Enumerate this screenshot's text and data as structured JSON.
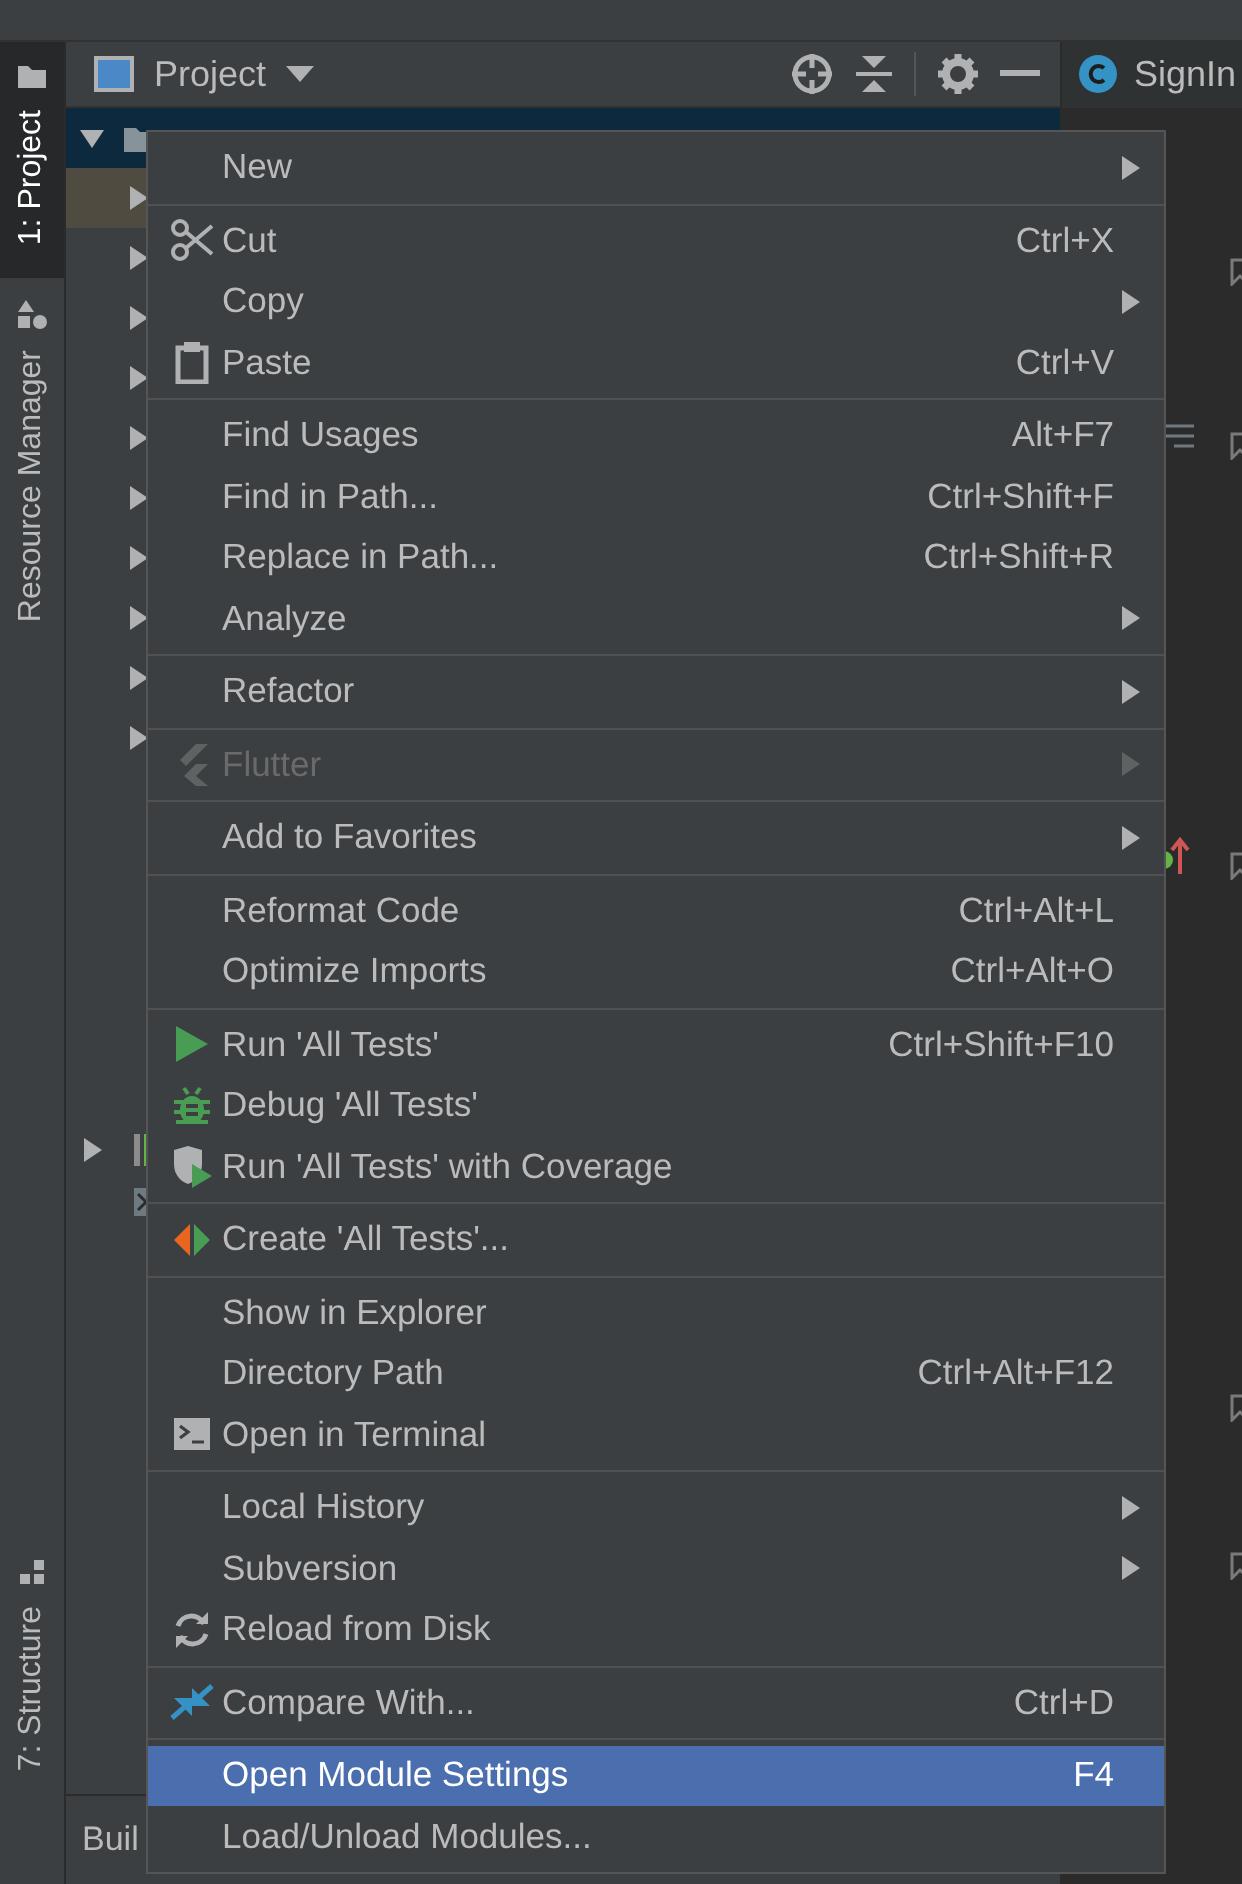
{
  "tool_strip": {
    "tabs": [
      {
        "label": "1: Project",
        "selected": true,
        "kind": "project"
      },
      {
        "label": "Resource Manager",
        "selected": false,
        "kind": "resources"
      }
    ],
    "bottom_tabs": [
      {
        "label": "7: Structure",
        "selected": false,
        "kind": "structure"
      }
    ]
  },
  "project_panel": {
    "title": "Project",
    "tree": {
      "root": {
        "expanded": true,
        "selected": true
      },
      "rows": [
        {
          "expanded": false,
          "selected": true
        },
        {
          "expanded": false,
          "selected": false
        },
        {
          "expanded": false,
          "selected": false
        },
        {
          "expanded": false,
          "selected": false
        },
        {
          "expanded": false,
          "selected": false
        },
        {
          "expanded": false,
          "selected": false
        },
        {
          "expanded": false,
          "selected": false
        },
        {
          "expanded": false,
          "selected": false
        },
        {
          "expanded": false,
          "selected": false
        },
        {
          "expanded": false,
          "selected": false
        }
      ],
      "lower_rows": [
        {
          "expanded": false,
          "kind": "library"
        },
        {
          "kind": "console"
        }
      ]
    },
    "bottom_tab": "Buil"
  },
  "editor": {
    "tab": "SignIn"
  },
  "context_menu": {
    "groups": [
      {
        "items": [
          {
            "label": "New",
            "submenu": true,
            "disabled": false,
            "selected": false,
            "kind": "plain"
          }
        ]
      },
      {
        "items": [
          {
            "label": "Cut",
            "shortcut": "Ctrl+X",
            "submenu": false,
            "disabled": false,
            "selected": false,
            "kind": "cut"
          },
          {
            "label": "Copy",
            "submenu": true,
            "disabled": false,
            "selected": false,
            "kind": "plain"
          },
          {
            "label": "Paste",
            "shortcut": "Ctrl+V",
            "submenu": false,
            "disabled": false,
            "selected": false,
            "kind": "paste"
          }
        ]
      },
      {
        "items": [
          {
            "label": "Find Usages",
            "shortcut": "Alt+F7",
            "submenu": false,
            "disabled": false,
            "selected": false,
            "kind": "plain"
          },
          {
            "label": "Find in Path...",
            "shortcut": "Ctrl+Shift+F",
            "submenu": false,
            "disabled": false,
            "selected": false,
            "kind": "plain"
          },
          {
            "label": "Replace in Path...",
            "shortcut": "Ctrl+Shift+R",
            "submenu": false,
            "disabled": false,
            "selected": false,
            "kind": "plain"
          },
          {
            "label": "Analyze",
            "submenu": true,
            "disabled": false,
            "selected": false,
            "kind": "plain"
          }
        ]
      },
      {
        "items": [
          {
            "label": "Refactor",
            "submenu": true,
            "disabled": false,
            "selected": false,
            "kind": "plain"
          }
        ]
      },
      {
        "items": [
          {
            "label": "Flutter",
            "submenu": true,
            "disabled": true,
            "selected": false,
            "kind": "flutter"
          }
        ]
      },
      {
        "items": [
          {
            "label": "Add to Favorites",
            "submenu": true,
            "disabled": false,
            "selected": false,
            "kind": "plain"
          }
        ]
      },
      {
        "items": [
          {
            "label": "Reformat Code",
            "shortcut": "Ctrl+Alt+L",
            "submenu": false,
            "disabled": false,
            "selected": false,
            "kind": "plain"
          },
          {
            "label": "Optimize Imports",
            "shortcut": "Ctrl+Alt+O",
            "submenu": false,
            "disabled": false,
            "selected": false,
            "kind": "plain"
          }
        ]
      },
      {
        "items": [
          {
            "label": "Run 'All Tests'",
            "shortcut": "Ctrl+Shift+F10",
            "submenu": false,
            "disabled": false,
            "selected": false,
            "kind": "run"
          },
          {
            "label": "Debug 'All Tests'",
            "submenu": false,
            "disabled": false,
            "selected": false,
            "kind": "debug"
          },
          {
            "label": "Run 'All Tests' with Coverage",
            "submenu": false,
            "disabled": false,
            "selected": false,
            "kind": "coverage"
          }
        ]
      },
      {
        "items": [
          {
            "label": "Create 'All Tests'...",
            "submenu": false,
            "disabled": false,
            "selected": false,
            "kind": "create"
          }
        ]
      },
      {
        "items": [
          {
            "label": "Show in Explorer",
            "submenu": false,
            "disabled": false,
            "selected": false,
            "kind": "plain"
          },
          {
            "label": "Directory Path",
            "shortcut": "Ctrl+Alt+F12",
            "submenu": false,
            "disabled": false,
            "selected": false,
            "kind": "plain"
          },
          {
            "label": "Open in Terminal",
            "submenu": false,
            "disabled": false,
            "selected": false,
            "kind": "terminal"
          }
        ]
      },
      {
        "items": [
          {
            "label": "Local History",
            "submenu": true,
            "disabled": false,
            "selected": false,
            "kind": "plain"
          },
          {
            "label": "Subversion",
            "submenu": true,
            "disabled": false,
            "selected": false,
            "kind": "plain"
          },
          {
            "label": "Reload from Disk",
            "submenu": false,
            "disabled": false,
            "selected": false,
            "kind": "reload"
          }
        ]
      },
      {
        "items": [
          {
            "label": "Compare With...",
            "shortcut": "Ctrl+D",
            "submenu": false,
            "disabled": false,
            "selected": false,
            "kind": "compare"
          }
        ]
      },
      {
        "items": [
          {
            "label": "Open Module Settings",
            "shortcut": "F4",
            "submenu": false,
            "disabled": false,
            "selected": true,
            "kind": "plain"
          },
          {
            "label": "Load/Unload Modules...",
            "submenu": false,
            "disabled": false,
            "selected": false,
            "kind": "plain"
          }
        ]
      }
    ]
  }
}
